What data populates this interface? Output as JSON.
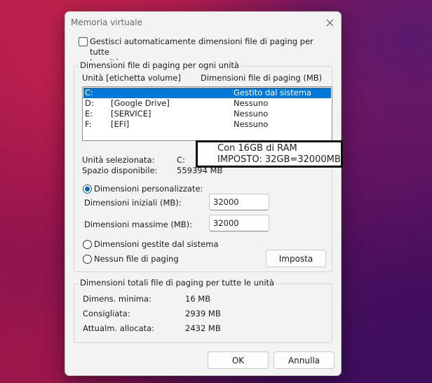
{
  "window": {
    "title": "Memoria virtuale"
  },
  "auto_manage": {
    "checked": false,
    "label_line1": "Gestisci automaticamente dimensioni file di paging per tutte",
    "label_line2": "le unità"
  },
  "drives_group": {
    "title": "Dimensioni file di paging per ogni unità",
    "col_drive": "Unità [etichetta volume]",
    "col_size": "Dimensioni file di paging (MB)",
    "rows": [
      {
        "drive": "C:",
        "label": "",
        "size": "Gestito dal sistema",
        "selected": true
      },
      {
        "drive": "D:",
        "label": "[Google Drive]",
        "size": "Nessuno",
        "selected": false
      },
      {
        "drive": "E:",
        "label": "[SERVICE]",
        "size": "Nessuno",
        "selected": false
      },
      {
        "drive": "F:",
        "label": "[EFI]",
        "size": "Nessuno",
        "selected": false
      }
    ],
    "selected_drive_label": "Unità selezionata:",
    "selected_drive_value": "C:",
    "free_space_label": "Spazio disponibile:",
    "free_space_value": "559394 MB",
    "custom_size_label": "Dimensioni personalizzate:",
    "initial_size_label": "Dimensioni iniziali (MB):",
    "initial_size_value": "32000",
    "max_size_label": "Dimensioni massime (MB):",
    "max_size_value": "32000",
    "system_managed_label": "Dimensioni gestite dal sistema",
    "no_paging_label": "Nessun file di paging",
    "set_button": "Imposta",
    "selected_option": "custom"
  },
  "totals_group": {
    "title": "Dimensioni totali file di paging per tutte le unità",
    "min_label": "Dimens. minima:",
    "min_value": "16 MB",
    "recommended_label": "Consigliata:",
    "recommended_value": "2939 MB",
    "allocated_label": "Attualm. allocata:",
    "allocated_value": "2432 MB"
  },
  "buttons": {
    "ok": "OK",
    "cancel": "Annulla"
  },
  "annotation": {
    "line1": "Con 16GB di RAM",
    "line2": "IMPOSTO: 32GB=32000MB"
  },
  "colors": {
    "selection": "#0078d7",
    "accent": "#005fb8"
  }
}
